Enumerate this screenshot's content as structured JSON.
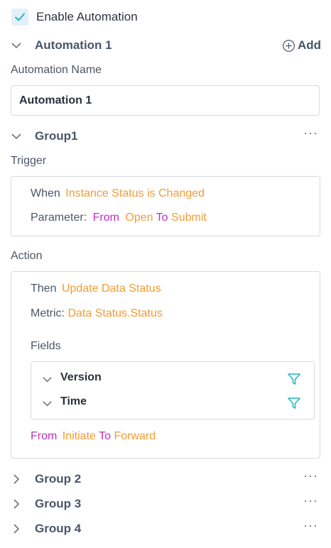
{
  "enable": {
    "label": "Enable Automation",
    "checked": true
  },
  "automation": {
    "title": "Automation 1",
    "add_label": "Add",
    "name_label": "Automation Name",
    "name_value": "Automation 1"
  },
  "group1": {
    "title": "Group1",
    "more": "···",
    "trigger_label": "Trigger",
    "trigger": {
      "when_word": "When",
      "when_value": "Instance Status is Changed",
      "param_word": "Parameter:",
      "from_word": "From",
      "from_value": "Open",
      "to_word": "To",
      "to_value": "Submit"
    },
    "action_label": "Action",
    "action": {
      "then_word": "Then",
      "then_value": "Update Data Status",
      "metric_word": "Metric:",
      "metric_value": "Data Status.Status",
      "fields_label": "Fields",
      "fields": [
        {
          "name": "Version"
        },
        {
          "name": "Time"
        }
      ],
      "from_word": "From",
      "from_value": "Initiate",
      "to_word": "To",
      "to_value": "Forward"
    }
  },
  "groups": [
    {
      "title": "Group 2",
      "more": "···"
    },
    {
      "title": "Group 3",
      "more": "···"
    },
    {
      "title": "Group 4",
      "more": "···"
    }
  ],
  "colors": {
    "accent_teal": "#1fb6c1",
    "value_orange": "#f39c34",
    "keyword_purple": "#c030c0"
  },
  "icons": {
    "check": "check-icon",
    "chevron_down": "chevron-down-icon",
    "chevron_right": "chevron-right-icon",
    "add": "plus-circle-icon",
    "filter": "filter-icon",
    "more": "more-icon"
  }
}
